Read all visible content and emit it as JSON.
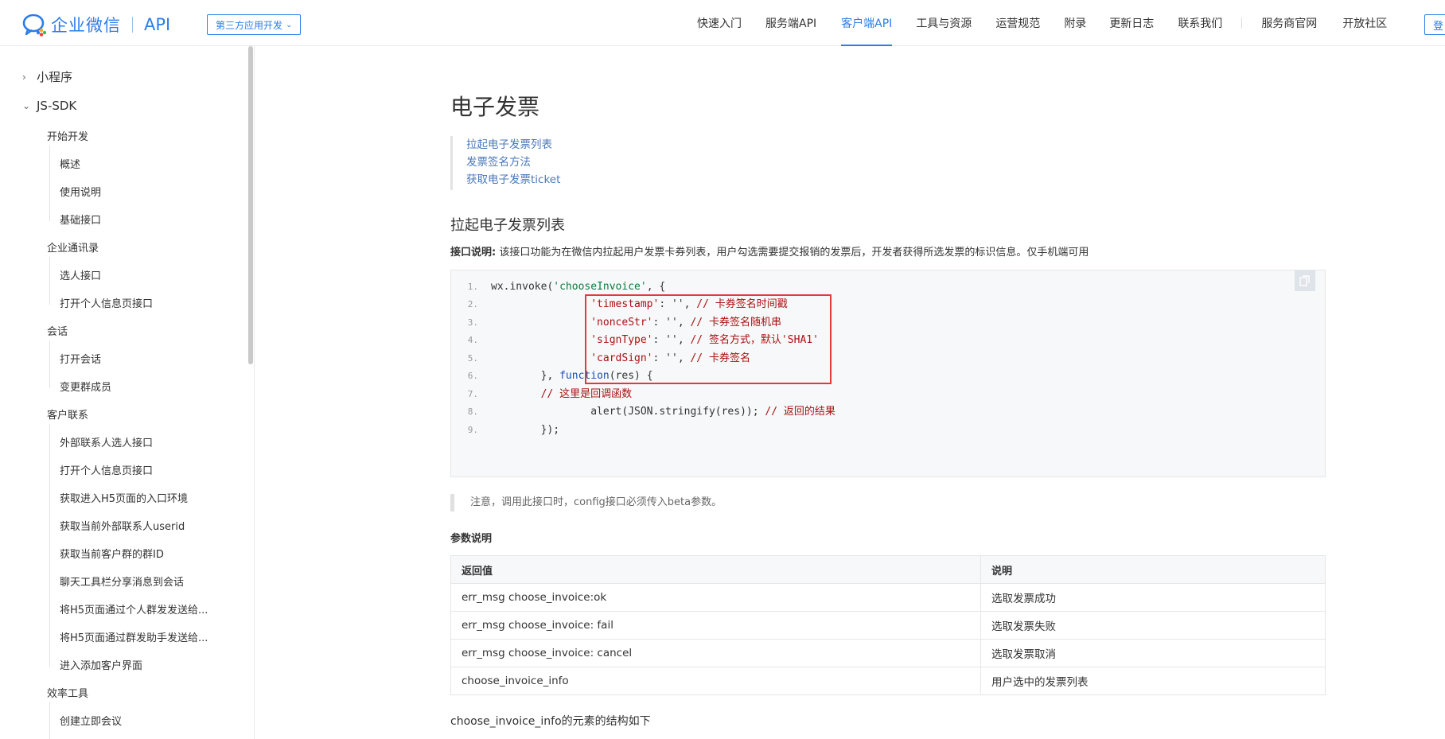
{
  "header": {
    "logo_text": "企业微信",
    "logo_api": "API",
    "dev_select": "第三方应用开发",
    "nav": [
      {
        "label": "快速入门",
        "active": false
      },
      {
        "label": "服务端API",
        "active": false
      },
      {
        "label": "客户端API",
        "active": true
      },
      {
        "label": "工具与资源",
        "active": false
      },
      {
        "label": "运营规范",
        "active": false
      },
      {
        "label": "附录",
        "active": false
      },
      {
        "label": "更新日志",
        "active": false
      },
      {
        "label": "联系我们",
        "active": false
      },
      {
        "label": "服务商官网",
        "active": false
      },
      {
        "label": "开放社区",
        "active": false
      }
    ],
    "login_label": "登",
    "accent_color": "#2b7de9"
  },
  "sidebar": {
    "top": [
      {
        "label": "小程序",
        "expanded": false
      },
      {
        "label": "JS-SDK",
        "expanded": true
      }
    ],
    "groups": [
      {
        "label": "开始开发",
        "items": [
          "概述",
          "使用说明",
          "基础接口"
        ]
      },
      {
        "label": "企业通讯录",
        "items": [
          "选人接口",
          "打开个人信息页接口"
        ]
      },
      {
        "label": "会话",
        "items": [
          "打开会话",
          "变更群成员"
        ]
      },
      {
        "label": "客户联系",
        "items": [
          "外部联系人选人接口",
          "打开个人信息页接口",
          "获取进入H5页面的入口环境",
          "获取当前外部联系人userid",
          "获取当前客户群的群ID",
          "聊天工具栏分享消息到会话",
          "将H5页面通过个人群发发送给...",
          "将H5页面通过群发助手发送给...",
          "进入添加客户界面"
        ]
      },
      {
        "label": "效率工具",
        "items": [
          "创建立即会议"
        ]
      }
    ]
  },
  "main": {
    "title": "电子发票",
    "toc": [
      "拉起电子发票列表",
      "发票签名方法",
      "获取电子发票ticket"
    ],
    "section_title": "拉起电子发票列表",
    "desc_label": "接口说明:",
    "desc_text": "该接口功能为在微信内拉起用户发票卡券列表，用户勾选需要提交报销的发票后，开发者获得所选发票的标识信息。仅手机端可用",
    "code": {
      "line1_a": "wx.invoke(",
      "line1_str": "'chooseInvoice'",
      "line1_b": ", {",
      "line2_key": "'timestamp'",
      "line2_val": ": '', ",
      "line2_cmt": "// 卡券签名时间戳",
      "line3_key": "'nonceStr'",
      "line3_val": ": '', ",
      "line3_cmt": "// 卡券签名随机串",
      "line4_key": "'signType'",
      "line4_val": ": '', ",
      "line4_cmt": "// 签名方式，默认'SHA1'",
      "line5_key": "'cardSign'",
      "line5_val": ": '', ",
      "line5_cmt": "// 卡券签名",
      "line6_a": "}, ",
      "line6_kw": "function",
      "line6_b": "(res) {",
      "line7_cmt": "// 这里是回调函数",
      "line8_a": "alert(JSON.stringify(res)); ",
      "line8_cmt": "// 返回的结果",
      "line9": "});"
    },
    "note": "注意，调用此接口时，config接口必须传入beta参数。",
    "params_title": "参数说明",
    "table": {
      "headers": [
        "返回值",
        "说明"
      ],
      "rows": [
        [
          "err_msg choose_invoice:ok",
          "选取发票成功"
        ],
        [
          "err_msg choose_invoice: fail",
          "选取发票失败"
        ],
        [
          "err_msg choose_invoice: cancel",
          "选取发票取消"
        ],
        [
          "choose_invoice_info",
          "用户选中的发票列表"
        ]
      ]
    },
    "struct_text": "choose_invoice_info的元素的结构如下"
  }
}
